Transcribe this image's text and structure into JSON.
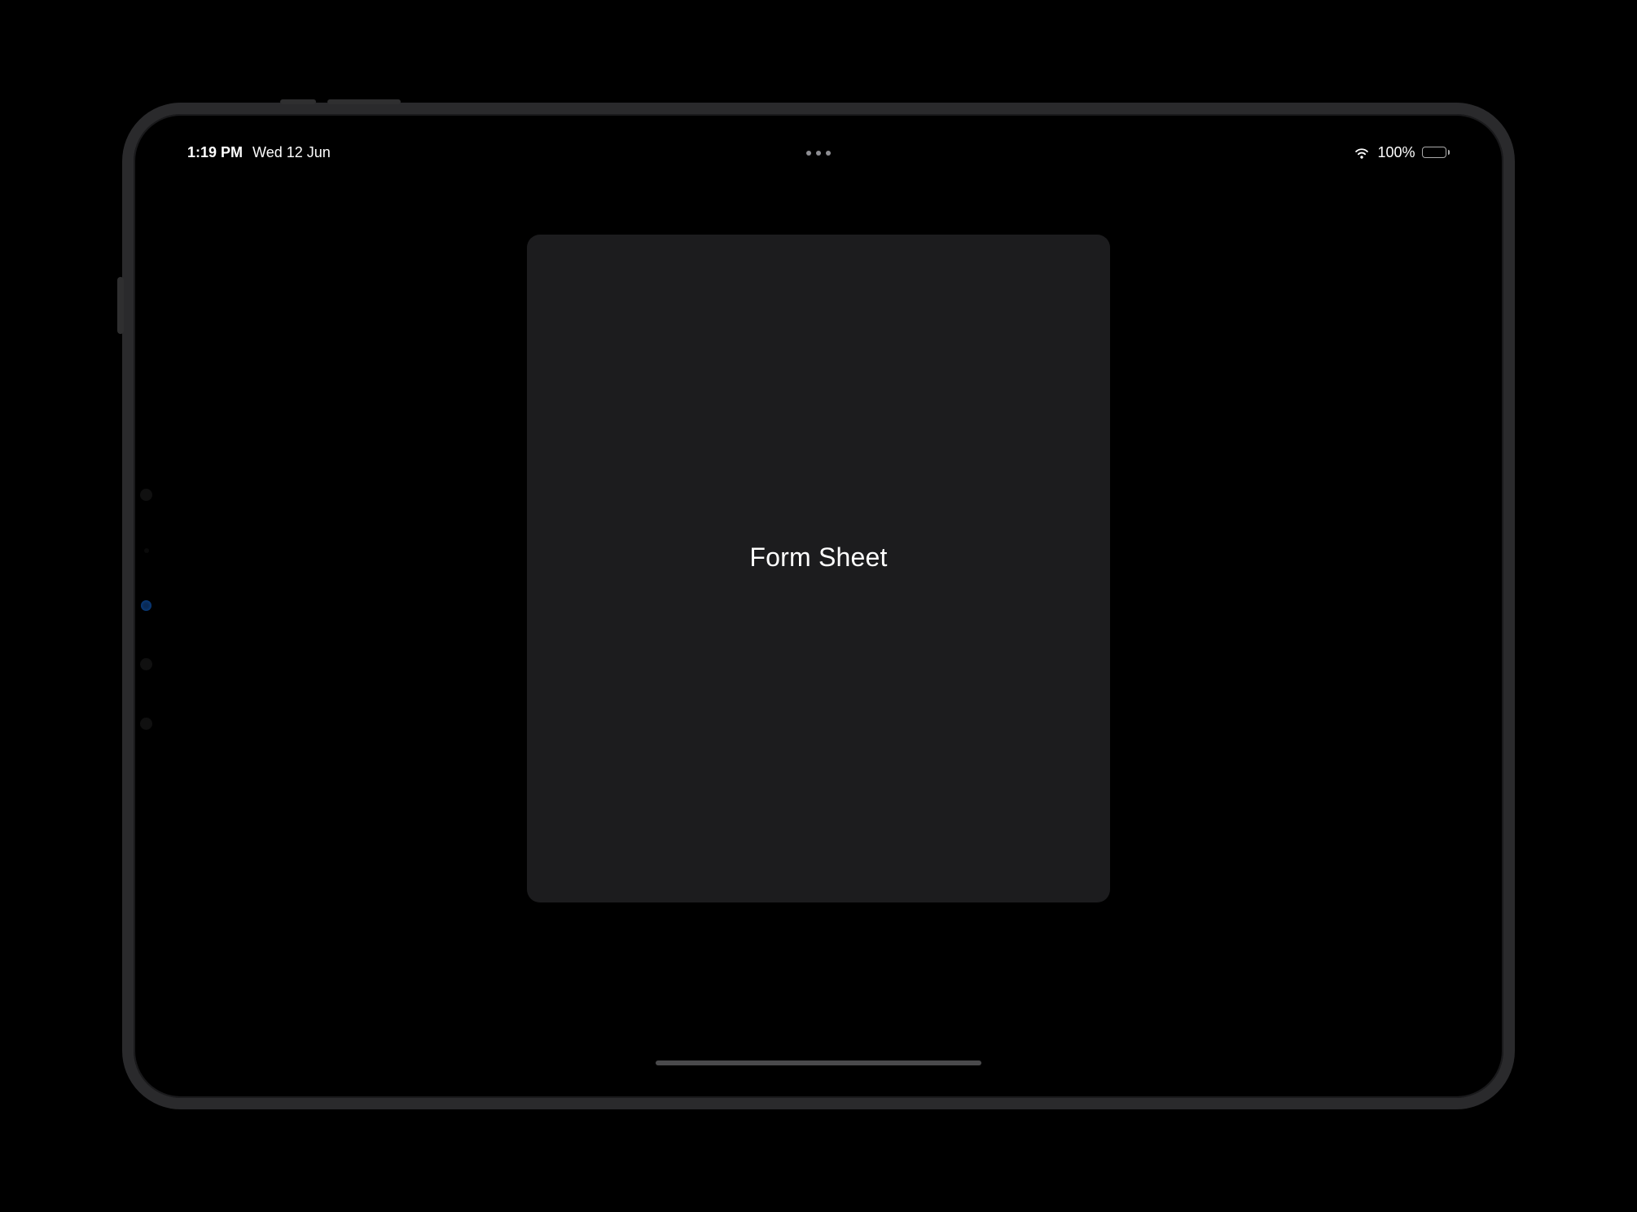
{
  "status_bar": {
    "time": "1:19 PM",
    "date": "Wed 12 Jun",
    "battery_percent": "100%",
    "battery_level": 100
  },
  "sheet": {
    "title": "Form Sheet"
  }
}
